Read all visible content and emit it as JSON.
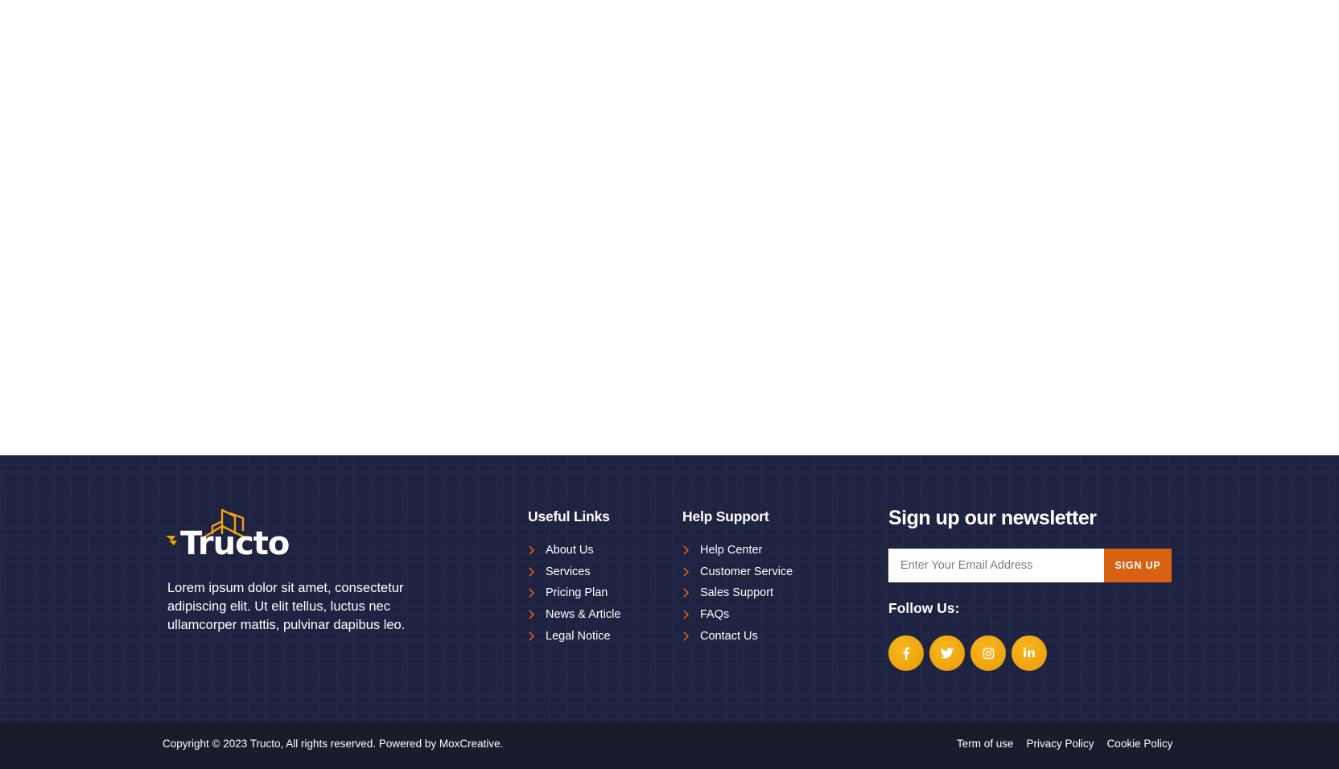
{
  "brand": {
    "name": "Tructo",
    "accent": "#f0a011",
    "orange": "#d96212",
    "footer_bg": "#1d2340",
    "bottom_bg": "#1a1c2b"
  },
  "about": {
    "text": "Lorem ipsum dolor sit amet, consectetur adipiscing elit. Ut elit tellus, luctus nec ullamcorper mattis, pulvinar dapibus leo."
  },
  "useful_links": {
    "title": "Useful Links",
    "items": [
      {
        "label": "About Us"
      },
      {
        "label": "Services"
      },
      {
        "label": "Pricing Plan"
      },
      {
        "label": "News & Article"
      },
      {
        "label": "Legal Notice"
      }
    ]
  },
  "help_support": {
    "title": "Help Support",
    "items": [
      {
        "label": "Help Center"
      },
      {
        "label": "Customer Service"
      },
      {
        "label": "Sales Support"
      },
      {
        "label": "FAQs"
      },
      {
        "label": "Contact Us"
      }
    ]
  },
  "newsletter": {
    "title": "Sign up our newsletter",
    "email_placeholder": "Enter Your Email Address",
    "button_label": "SIGN UP",
    "follow_label": "Follow Us:",
    "socials": [
      {
        "name": "facebook-icon"
      },
      {
        "name": "twitter-icon"
      },
      {
        "name": "instagram-icon"
      },
      {
        "name": "linkedin-icon",
        "text": "in"
      }
    ]
  },
  "bottom": {
    "copyright": "Copyright © 2023 Tructo, All rights reserved. Powered by MoxCreative.",
    "links": [
      {
        "label": "Term of use"
      },
      {
        "label": "Privacy Policy"
      },
      {
        "label": "Cookie Policy"
      }
    ]
  }
}
